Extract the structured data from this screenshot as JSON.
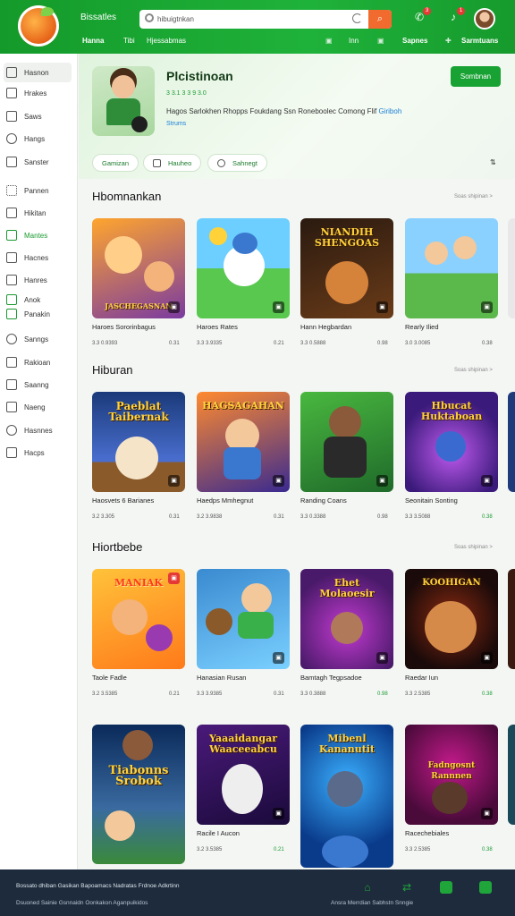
{
  "topbar": {
    "brand": "Bissatles",
    "search_placeholder": "hibuigtnkan",
    "search_button_icon": "search-icon",
    "nav": [
      {
        "label": "Hanna",
        "bold": true
      },
      {
        "label": "Tibi",
        "bold": false
      },
      {
        "label": "Hjessabmas",
        "bold": false
      },
      {
        "label": "Inn",
        "bold": false
      },
      {
        "label": "Sapnes",
        "bold": true
      },
      {
        "label": "Sarmtuans",
        "bold": true
      }
    ],
    "notification_count": "3",
    "message_count": "1"
  },
  "sidebar": {
    "items": [
      {
        "label": "Hasnon",
        "icon": "home-icon"
      },
      {
        "label": "Hrakes",
        "icon": "star-icon"
      },
      {
        "label": "Saws",
        "icon": "grid-icon"
      },
      {
        "label": "Hangs",
        "icon": "heart-icon"
      },
      {
        "label": "Sanster",
        "icon": "share-icon"
      },
      {
        "label": "Pannen",
        "icon": "apps-icon"
      },
      {
        "label": "Hikitan",
        "icon": "list-icon"
      },
      {
        "label": "Mantes",
        "icon": "check-icon"
      },
      {
        "label": "Hacnes",
        "icon": "folder-icon"
      },
      {
        "label": "Hanres",
        "icon": "tag-icon"
      },
      {
        "label": "Anok",
        "icon": "group-icon"
      },
      {
        "label": "Panakin",
        "icon": "play-icon"
      },
      {
        "label": "Sanngs",
        "icon": "settings-icon"
      },
      {
        "label": "Rakioan",
        "icon": "book-icon"
      },
      {
        "label": "Saanng",
        "icon": "chat-icon"
      },
      {
        "label": "Naeng",
        "icon": "trophy-icon"
      },
      {
        "label": "Hasnnes",
        "icon": "gift-icon"
      },
      {
        "label": "Hacps",
        "icon": "info-icon"
      }
    ]
  },
  "hero": {
    "title": "Plcistinoan",
    "meta": "3 3.1 3 3 9 3.0",
    "description": "Hagos Sarlokhen Rhopps Foukdang Ssn Roneboolec Comong Flif",
    "description_link": "Giriboh",
    "link": "Strums",
    "play_label": "Sombnan",
    "pills": [
      {
        "label": "Gamizan",
        "icon": ""
      },
      {
        "label": "Hauheo",
        "icon": "grid-icon"
      },
      {
        "label": "Sahnegt",
        "icon": "share-icon"
      }
    ],
    "sort_icon": "sort-icon"
  },
  "sections": [
    {
      "title": "Hbomnankan",
      "more": "Soas shipinan >",
      "cards": [
        {
          "name": "Haroes Sororinbagus",
          "meta": "3.3  0.9393",
          "count": "0.31",
          "overlay": "JASCHEGASNAN",
          "bg1": "#ffa52e",
          "bg2": "#7a3aa0"
        },
        {
          "name": "Haroes Rates",
          "meta": "3.3  3.9335",
          "count": "0.21",
          "overlay": "",
          "bg1": "#4fc3ff",
          "bg2": "#58c84e"
        },
        {
          "name": "Hann Hegbardan",
          "meta": "3.3  0.5888",
          "count": "0.98",
          "overlay": "NIANDIH SHENGOAS",
          "bg1": "#2a1a10",
          "bg2": "#6a3b18"
        },
        {
          "name": "Rearly Ilied",
          "meta": "3.0  3.0085",
          "count": "0.38",
          "overlay": "",
          "bg1": "#8ad1ff",
          "bg2": "#5bb84a"
        }
      ]
    },
    {
      "title": "Hiburan",
      "more": "Soas shipinan >",
      "cards": [
        {
          "name": "Haosvets 6 Barianes",
          "meta": "3.2  3.305",
          "count": "0.31",
          "overlay": "Paeblat Taibernak",
          "bg1": "#1b3a7a",
          "bg2": "#4a6fd0"
        },
        {
          "name": "Haedps Mmhegnut",
          "meta": "3.2  3.9838",
          "count": "0.31",
          "overlay": "HAGSAGAHAN",
          "bg1": "#ff8a2e",
          "bg2": "#3a2a90"
        },
        {
          "name": "Randing Coans",
          "meta": "3.3  0.3388",
          "count": "0.98",
          "overlay": "",
          "bg1": "#49b83f",
          "bg2": "#1f6a2a"
        },
        {
          "name": "Seonitain Sonting",
          "meta": "3.3  3.5088",
          "count": "0.38",
          "overlay": "Hbucat Huktaboan",
          "bg1": "#3a1a7a",
          "bg2": "#9a3ad0"
        }
      ]
    },
    {
      "title": "Hiortbebe",
      "more": "Soas shipinan >",
      "cards": [
        {
          "name": "Taole Fadle",
          "meta": "3.2  3.5385",
          "count": "0.21",
          "overlay": "MANIAK",
          "bg1": "#ffc23a",
          "bg2": "#ff7a1a"
        },
        {
          "name": "Hanasian Rusan",
          "meta": "3.3  3.9385",
          "count": "0.31",
          "overlay": "",
          "bg1": "#3a8ad0",
          "bg2": "#7ad0ff"
        },
        {
          "name": "Bamtagh Tegpsadoe",
          "meta": "3.3  0.3888",
          "count": "0.98",
          "overlay": "Ehet Molaoesir",
          "bg1": "#4a1a6a",
          "bg2": "#c23ad0"
        },
        {
          "name": "Raedar Iun",
          "meta": "3.3  2.5385",
          "count": "0.38",
          "overlay": "KOOHIGAN",
          "bg1": "#1a0a0a",
          "bg2": "#8a2a10"
        }
      ]
    },
    {
      "title": "",
      "more": "",
      "cards": [
        {
          "name": "",
          "meta": "",
          "count": "",
          "overlay": "Tiabonns Srobok",
          "bg1": "#0a2a5a",
          "bg2": "#3a8a3a"
        },
        {
          "name": "Racile I Aucon",
          "meta": "3.2  3.5385",
          "count": "0.21",
          "overlay": "Yaaaidangar Waaceeabcu",
          "bg1": "#4a1a7a",
          "bg2": "#1a0a3a"
        },
        {
          "name": "",
          "meta": "",
          "count": "",
          "overlay": "Mibenl Kananutit",
          "bg1": "#0a3a8a",
          "bg2": "#3ab0ff"
        },
        {
          "name": "Racechebiales",
          "meta": "3.3  2.5385",
          "count": "0.38",
          "overlay": "Fadngosnt Rannnen",
          "bg1": "#4a0a3a",
          "bg2": "#c21a8a"
        }
      ]
    }
  ],
  "footer": {
    "line1": "Bossato dhiban Gasikan Bapoamacs Nadratas Frdnoe Adkrtinn",
    "line2": "Dsuoned Sainie Gsnnaidn Oonkakon Aganpuikidos",
    "line3": "Ansra Merrdian Sabhstn Snngie",
    "icons": [
      "home-icon",
      "swap-icon",
      "image-icon",
      "store-icon"
    ]
  },
  "colors": {
    "accent": "#1a9a30",
    "topbar": "#1fb23a",
    "footer": "#1d2b3c",
    "search_button": "#f26b2e"
  }
}
